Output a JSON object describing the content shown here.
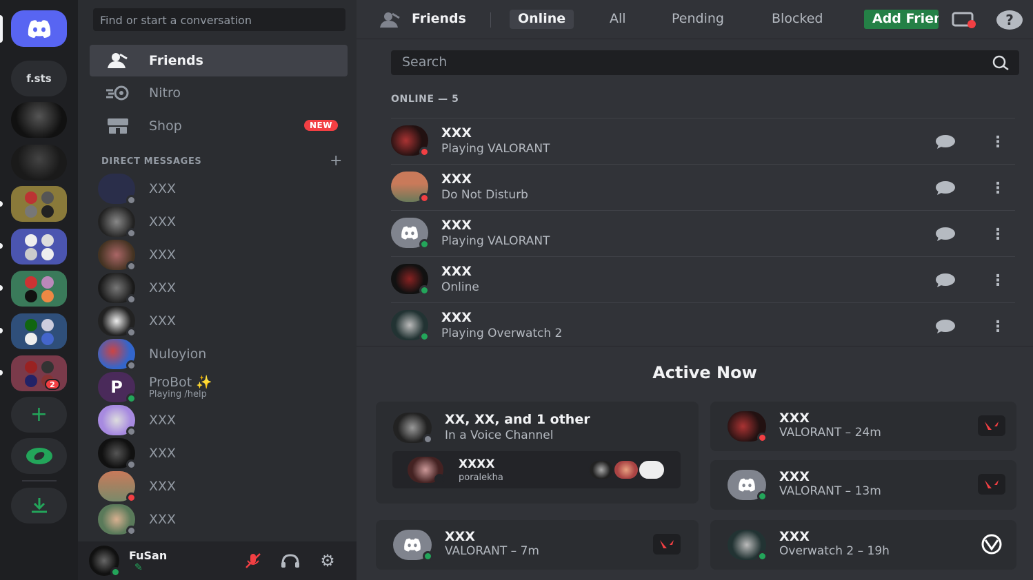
{
  "servers": {
    "home_label": "discord-logo",
    "text_server": "f.sts",
    "badge_count": "2"
  },
  "sidebar": {
    "search_placeholder": "Find or start a conversation",
    "nav": {
      "friends": "Friends",
      "nitro": "Nitro",
      "shop": "Shop",
      "shop_tag": "NEW"
    },
    "dm_header": "DIRECT MESSAGES",
    "dm_add": "+",
    "dms": [
      {
        "name": "XXX",
        "status": "offline"
      },
      {
        "name": "XXX",
        "status": "offline"
      },
      {
        "name": "XXX",
        "status": "offline"
      },
      {
        "name": "XXX",
        "status": "offline"
      },
      {
        "name": "XXX",
        "status": "offline"
      },
      {
        "name": "Nuloyion",
        "status": "offline"
      },
      {
        "name": "ProBot ✨",
        "sub": "Playing /help",
        "status": "online"
      },
      {
        "name": "XXX",
        "status": "offline"
      },
      {
        "name": "XXX",
        "status": "offline"
      },
      {
        "name": "XXX",
        "status": "dnd"
      },
      {
        "name": "XXX",
        "status": "offline"
      }
    ],
    "user": {
      "name": "FuSan"
    }
  },
  "topbar": {
    "title": "Friends",
    "tabs": {
      "online": "Online",
      "all": "All",
      "pending": "Pending",
      "blocked": "Blocked",
      "add": "Add Friend"
    }
  },
  "search_placeholder": "Search",
  "online_header": "ONLINE — 5",
  "friends": [
    {
      "name": "XXX",
      "status": "Playing VALORANT",
      "presence": "dnd"
    },
    {
      "name": "XXX",
      "status": "Do Not Disturb",
      "presence": "dnd"
    },
    {
      "name": "XXX",
      "status": "Playing VALORANT",
      "presence": "online"
    },
    {
      "name": "XXX",
      "status": "Online",
      "presence": "online"
    },
    {
      "name": "XXX",
      "status": "Playing Overwatch 2",
      "presence": "online"
    }
  ],
  "active_now": {
    "title": "Active Now",
    "voice_card": {
      "title": "XX, XX, and 1 other",
      "sub": "In a Voice Channel",
      "channel_user": "XXXX",
      "channel_sub": "poralekha"
    },
    "cards": [
      {
        "name": "XXX",
        "activity": "VALORANT – 7m",
        "game": "valorant"
      },
      {
        "name": "XXX",
        "activity": "VALORANT – 24m",
        "game": "valorant"
      },
      {
        "name": "XXX",
        "activity": "VALORANT – 13m",
        "game": "valorant"
      },
      {
        "name": "XXX",
        "activity": "Overwatch 2 – 19h",
        "game": "overwatch"
      }
    ]
  },
  "colors": {
    "accent": "#5865f2",
    "online": "#23a55a",
    "dnd": "#f23f43",
    "offline": "#80848e",
    "add_friend": "#248046"
  }
}
